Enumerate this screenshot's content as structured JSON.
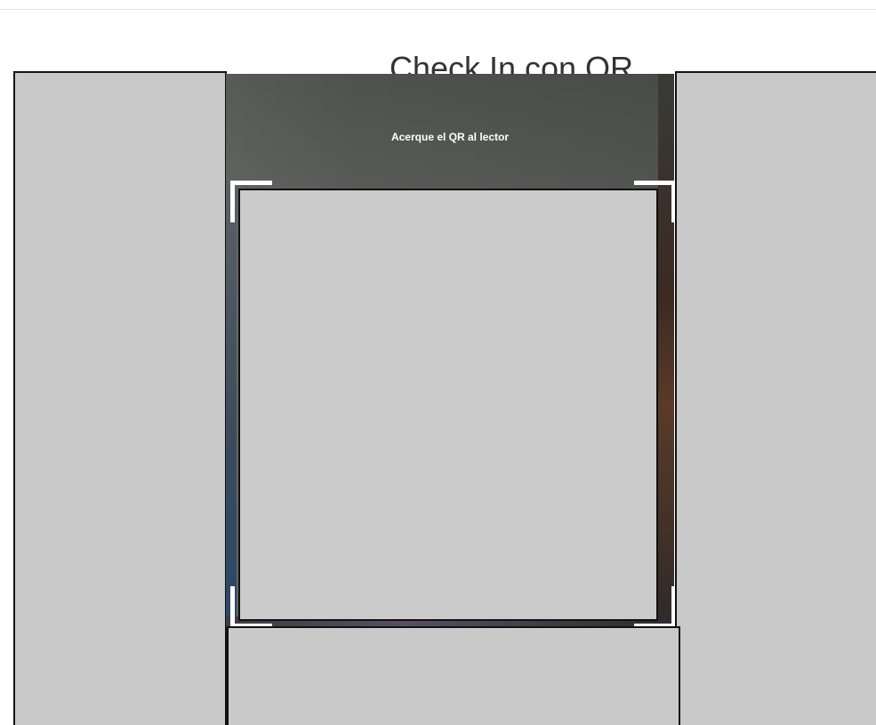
{
  "page": {
    "title": "Check In con QR"
  },
  "scanner": {
    "hint": "Acerque el QR al lector"
  },
  "colors": {
    "placeholder_fill": "#cbcbcb",
    "placeholder_border": "#111111",
    "corner_marker": "#ffffff",
    "title_text": "#333333"
  }
}
